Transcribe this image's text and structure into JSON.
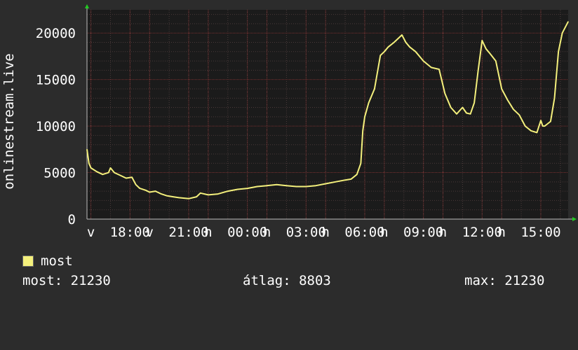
{
  "chart_data": {
    "type": "line",
    "ylabel": "onlinestream.live",
    "ylim": [
      0,
      22500
    ],
    "yticks": [
      0,
      5000,
      10000,
      15000,
      20000
    ],
    "ytick_labels": [
      "0",
      "5000",
      "10000",
      "15000",
      "20000"
    ],
    "x_range_hours": [
      15.8,
      40.4
    ],
    "xticks": [
      {
        "hour": 16.0,
        "label": "v"
      },
      {
        "hour": 18.0,
        "label": "18:00"
      },
      {
        "hour": 19.0,
        "label": "v"
      },
      {
        "hour": 21.0,
        "label": "21:00"
      },
      {
        "hour": 22.0,
        "label": "h"
      },
      {
        "hour": 24.0,
        "label": "00:00"
      },
      {
        "hour": 25.0,
        "label": "h"
      },
      {
        "hour": 27.0,
        "label": "03:00"
      },
      {
        "hour": 28.0,
        "label": "h"
      },
      {
        "hour": 30.0,
        "label": "06:00"
      },
      {
        "hour": 31.0,
        "label": "h"
      },
      {
        "hour": 33.0,
        "label": "09:00"
      },
      {
        "hour": 34.0,
        "label": "h"
      },
      {
        "hour": 36.0,
        "label": "12:00"
      },
      {
        "hour": 37.0,
        "label": "h"
      },
      {
        "hour": 39.0,
        "label": "15:00"
      }
    ],
    "grid": true,
    "series": [
      {
        "name": "most",
        "color": "#f4f07c",
        "x": [
          15.8,
          15.9,
          16.0,
          16.3,
          16.6,
          16.9,
          17.0,
          17.2,
          17.5,
          17.8,
          18.1,
          18.3,
          18.5,
          18.8,
          19.0,
          19.3,
          19.6,
          19.9,
          20.2,
          20.5,
          21.0,
          21.4,
          21.6,
          22.0,
          22.5,
          23.0,
          23.5,
          24.0,
          24.5,
          25.0,
          25.5,
          26.0,
          26.5,
          27.0,
          27.5,
          28.0,
          28.5,
          29.0,
          29.3,
          29.6,
          29.8,
          29.9,
          30.0,
          30.2,
          30.5,
          30.8,
          31.0,
          31.2,
          31.5,
          31.9,
          32.1,
          32.3,
          32.6,
          33.0,
          33.4,
          33.8,
          34.1,
          34.4,
          34.7,
          35.0,
          35.2,
          35.4,
          35.6,
          35.8,
          36.0,
          36.2,
          36.4,
          36.7,
          37.0,
          37.3,
          37.6,
          37.9,
          38.2,
          38.5,
          38.8,
          39.0,
          39.1,
          39.2,
          39.5,
          39.7,
          39.9,
          40.1,
          40.4
        ],
        "values": [
          7500,
          6000,
          5500,
          5100,
          4800,
          5000,
          5500,
          5000,
          4700,
          4400,
          4500,
          3700,
          3300,
          3100,
          2900,
          3000,
          2700,
          2500,
          2400,
          2300,
          2200,
          2400,
          2800,
          2600,
          2700,
          3000,
          3200,
          3300,
          3500,
          3600,
          3700,
          3600,
          3500,
          3500,
          3600,
          3800,
          4000,
          4200,
          4300,
          4800,
          6000,
          9500,
          11000,
          12500,
          14000,
          17600,
          18000,
          18500,
          19000,
          19800,
          19000,
          18500,
          18000,
          17000,
          16300,
          16100,
          13500,
          12000,
          11300,
          12000,
          11400,
          11300,
          12500,
          16000,
          19200,
          18300,
          17800,
          17000,
          14000,
          12800,
          11800,
          11200,
          10000,
          9500,
          9300,
          10600,
          10000,
          10000,
          10500,
          13000,
          18000,
          20000,
          21230
        ]
      }
    ]
  },
  "legend": {
    "label": "most",
    "color": "#f4f07c"
  },
  "stats": {
    "current": "most: 21230",
    "average": "átlag: 8803",
    "max": "max: 21230"
  }
}
